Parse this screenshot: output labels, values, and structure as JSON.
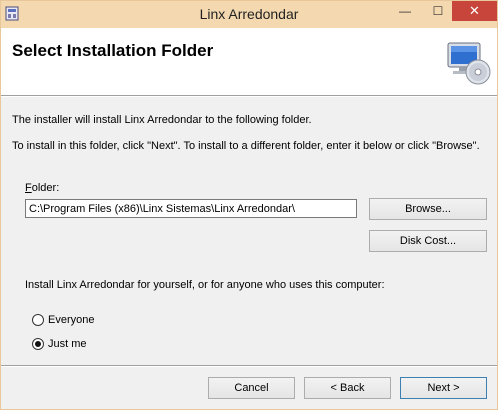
{
  "window": {
    "title": "Linx Arredondar",
    "minimize_glyph": "—",
    "maximize_glyph": "☐",
    "close_glyph": "✕"
  },
  "header": {
    "title": "Select Installation Folder",
    "art_icon": "computer-cd-icon"
  },
  "body": {
    "intro_text": "The installer will install Linx Arredondar to the following folder.",
    "instructions_text": "To install in this folder, click \"Next\". To install to a different folder, enter it below or click \"Browse\".",
    "folder_label_accel": "F",
    "folder_label_rest": "older:",
    "folder_value": "C:\\Program Files (x86)\\Linx Sistemas\\Linx Arredondar\\",
    "browse_label": "Browse...",
    "disk_cost_label": "Disk Cost...",
    "scope_question": "Install Linx Arredondar for yourself, or for anyone who uses this computer:",
    "options": [
      {
        "label": "Everyone",
        "selected": false
      },
      {
        "label": "Just me",
        "selected": true
      }
    ]
  },
  "footer": {
    "cancel_label": "Cancel",
    "back_label": "< Back",
    "next_label": "Next >"
  },
  "colors": {
    "titlebar": "#f4d9b0",
    "close_button": "#c7453a",
    "next_border": "#3c7fb1"
  }
}
